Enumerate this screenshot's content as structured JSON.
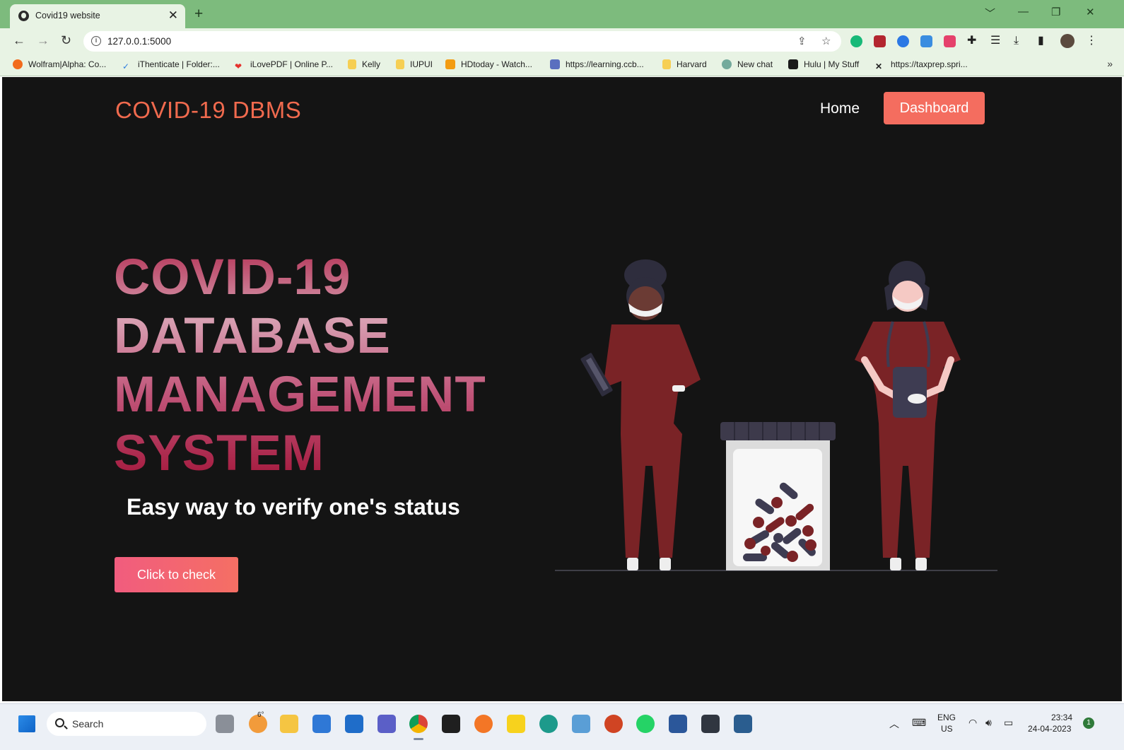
{
  "browser": {
    "tab_title": "Covid19 website",
    "tab_close": "✕",
    "new_tab": "+",
    "url": "127.0.0.1:5000",
    "window_controls": [
      "﹀",
      "—",
      "❐",
      "✕"
    ],
    "bookmarks": [
      {
        "label": "Wolfram|Alpha: Co...",
        "color": "#f26b1d"
      },
      {
        "label": "iThenticate | Folder:...",
        "color": "#2d7de0"
      },
      {
        "label": "iLovePDF | Online P...",
        "color": "#e5322d"
      },
      {
        "label": "Kelly",
        "color": "#f6cf54"
      },
      {
        "label": "IUPUI",
        "color": "#f6cf54"
      },
      {
        "label": "HDtoday - Watch...",
        "color": "#f39c12"
      },
      {
        "label": "https://learning.ccb...",
        "color": "#5a6fbf"
      },
      {
        "label": "Harvard",
        "color": "#f6cf54"
      },
      {
        "label": "New chat",
        "color": "#74aa9c"
      },
      {
        "label": "Hulu | My Stuff",
        "color": "#1a1a1a"
      },
      {
        "label": "https://taxprep.spri...",
        "color": "#222222"
      }
    ],
    "bookmarks_more": "»"
  },
  "site": {
    "brand": "COVID-19 DBMS",
    "nav": {
      "home": "Home",
      "dashboard": "Dashboard"
    },
    "hero_lines": [
      "COVID-19",
      "DATABASE",
      "MANAGEMENT",
      "SYSTEM"
    ],
    "subtitle": "Easy way to verify one's status",
    "cta": "Click to check",
    "colors": {
      "background": "#141414",
      "brand": "#f06a4e",
      "accent": "#f46d5f",
      "scrubs": "#7a2326"
    }
  },
  "taskbar": {
    "search_label": "Search",
    "weather_temp": "6°",
    "lang_top": "ENG",
    "lang_bottom": "US",
    "time": "23:34",
    "date": "24-04-2023",
    "notification_count": "1"
  }
}
